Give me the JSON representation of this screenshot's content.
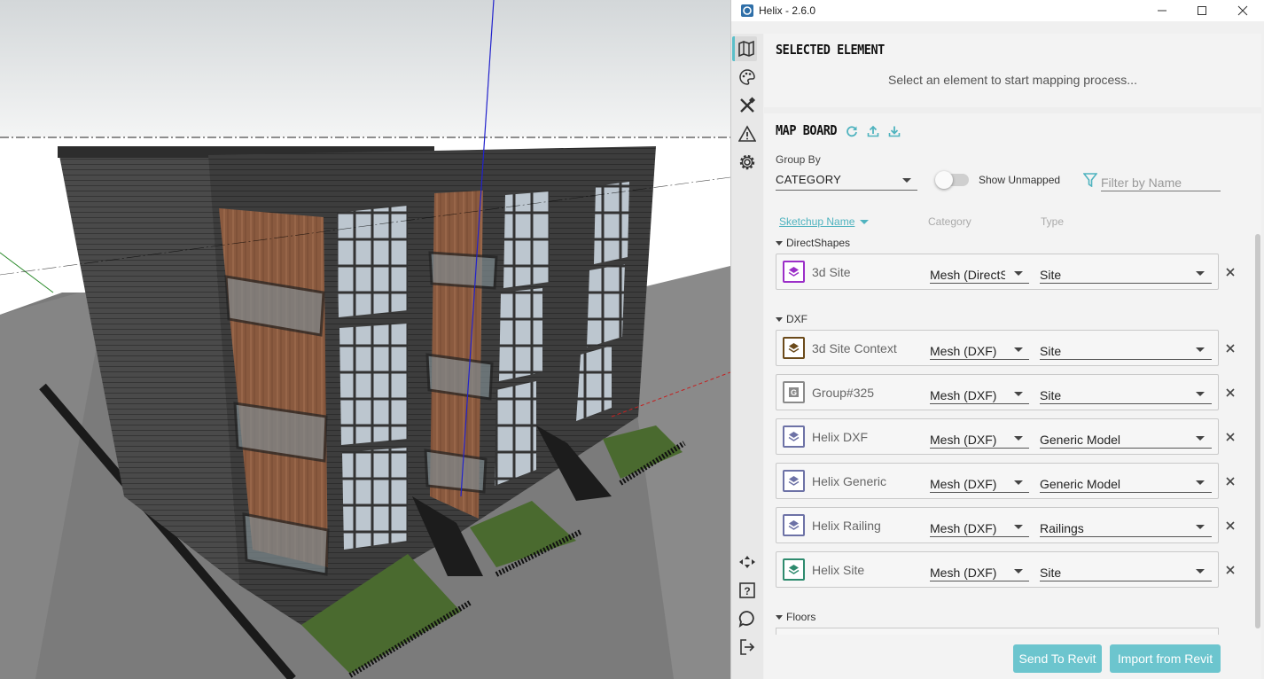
{
  "window": {
    "title": "Helix - 2.6.0"
  },
  "rail": {
    "top_items": [
      "map-icon",
      "palette-icon",
      "tools-icon",
      "warning-icon",
      "gear-icon"
    ],
    "bottom_items": [
      "navigation-icon",
      "help-icon",
      "chat-icon",
      "logout-icon"
    ],
    "active": "map-icon"
  },
  "selected_element": {
    "title": "SELECTED ELEMENT",
    "message": "Select an element to start mapping process..."
  },
  "map_board": {
    "title": "MAP BOARD",
    "group_by_label": "Group By",
    "group_by_value": "CATEGORY",
    "show_unmapped_label": "Show Unmapped",
    "show_unmapped": false,
    "filter_placeholder": "Filter by Name",
    "columns": {
      "sketchup": "Sketchup Name",
      "category": "Category",
      "type": "Type"
    },
    "groups": [
      {
        "name": "DirectShapes",
        "rows": [
          {
            "name": "3d Site",
            "category": "Mesh (DirectShape)",
            "type": "Site",
            "icon": "layer-icon",
            "color": "#9b2fc8"
          }
        ]
      },
      {
        "name": "DXF",
        "rows": [
          {
            "name": "3d Site Context",
            "category": "Mesh (DXF)",
            "type": "Site",
            "icon": "layer-icon",
            "color": "#6b4a1a"
          },
          {
            "name": "Group#325",
            "category": "Mesh (DXF)",
            "type": "Site",
            "icon": "group-icon",
            "color": "#8a8a8a"
          },
          {
            "name": "Helix DXF",
            "category": "Mesh (DXF)",
            "type": "Generic Model",
            "icon": "layer-icon",
            "color": "#6d72a6"
          },
          {
            "name": "Helix Generic",
            "category": "Mesh (DXF)",
            "type": "Generic Model",
            "icon": "layer-icon",
            "color": "#6d72a6"
          },
          {
            "name": "Helix Railing",
            "category": "Mesh (DXF)",
            "type": "Railings",
            "icon": "layer-icon",
            "color": "#6d72a6"
          },
          {
            "name": "Helix Site",
            "category": "Mesh (DXF)",
            "type": "Site",
            "icon": "layer-icon",
            "color": "#2e8b6e"
          }
        ]
      },
      {
        "name": "Floors",
        "rows": []
      }
    ]
  },
  "footer": {
    "send_label": "Send To Revit",
    "import_label": "Import from Revit"
  },
  "colors": {
    "accent": "#5bbfc9",
    "button": "#6cc5ce"
  }
}
